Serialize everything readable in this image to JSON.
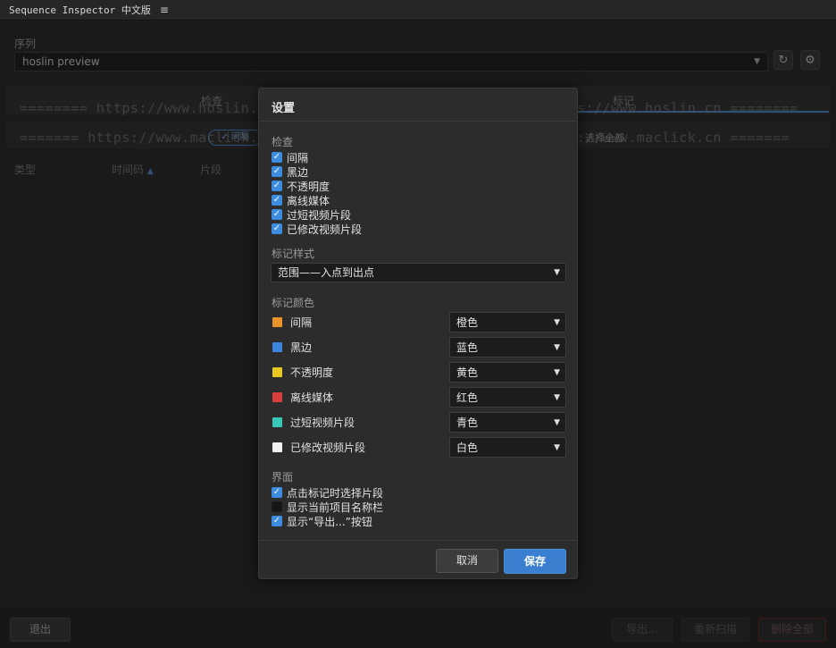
{
  "window": {
    "title": "Sequence Inspector 中文版",
    "menu_icon": "≡"
  },
  "background": {
    "sequence_label": "序列",
    "sequence_value": "hoslin preview",
    "refresh_icon": "↻",
    "settings_icon": "⚙",
    "tabs": {
      "inspect": "检查",
      "markers": "标记"
    },
    "filter_pill": "✓ 间隔",
    "filter_right": "选择全部",
    "columns": {
      "type": "类型",
      "timecode": "时间码",
      "clip": "片段",
      "sort_icon": "▲"
    },
    "buttons": {
      "exit": "退出",
      "export": "导出...",
      "rescan": "重新扫描",
      "delete_all": "删除全部"
    }
  },
  "watermarks": [
    "======== https://www.hoslin.cn ========",
    "======== https://www.hoslin.cn ========",
    "======= https://www.maclick.cn ========",
    "======= https://www.maclick.cn ======="
  ],
  "dialog": {
    "title": "设置",
    "inspect_section": {
      "title": "检查",
      "items": [
        {
          "label": "间隔",
          "checked": true
        },
        {
          "label": "黑边",
          "checked": true
        },
        {
          "label": "不透明度",
          "checked": true
        },
        {
          "label": "离线媒体",
          "checked": true
        },
        {
          "label": "过短视频片段",
          "checked": true
        },
        {
          "label": "已修改视频片段",
          "checked": true
        }
      ]
    },
    "marker_style": {
      "title": "标记样式",
      "value": "范围——入点到出点"
    },
    "marker_colors": {
      "title": "标记颜色",
      "items": [
        {
          "label": "间隔",
          "color": "#e8942a",
          "value": "橙色"
        },
        {
          "label": "黑边",
          "color": "#3d86e0",
          "value": "蓝色"
        },
        {
          "label": "不透明度",
          "color": "#e8c820",
          "value": "黄色"
        },
        {
          "label": "离线媒体",
          "color": "#d84040",
          "value": "红色"
        },
        {
          "label": "过短视频片段",
          "color": "#38c8b8",
          "value": "青色"
        },
        {
          "label": "已修改视频片段",
          "color": "#f0f0f0",
          "value": "白色"
        }
      ]
    },
    "interface_section": {
      "title": "界面",
      "items": [
        {
          "label": "点击标记时选择片段",
          "checked": true
        },
        {
          "label": "显示当前项目名称栏",
          "checked": false
        },
        {
          "label": "显示“导出...”按钮",
          "checked": true
        }
      ]
    },
    "check_mark": "✓",
    "dropdown_arrow": "▼",
    "buttons": {
      "cancel": "取消",
      "save": "保存"
    }
  }
}
